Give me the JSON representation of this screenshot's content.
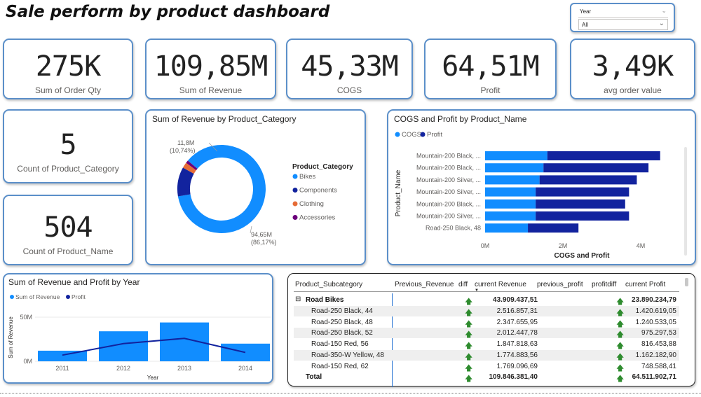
{
  "dashboard_title": "Sale perform by product dashboard",
  "slicer": {
    "label": "Year",
    "value": "All"
  },
  "kpis": [
    {
      "value": "275K",
      "label": "Sum of Order Qty"
    },
    {
      "value": "109,85M",
      "label": "Sum of Revenue"
    },
    {
      "value": "45,33M",
      "label": "COGS"
    },
    {
      "value": "64,51M",
      "label": "Profit"
    },
    {
      "value": "3,49K",
      "label": "avg order value"
    },
    {
      "value": "5",
      "label": "Count of Product_Category"
    },
    {
      "value": "504",
      "label": "Count of Product_Name"
    }
  ],
  "donut": {
    "title": "Sum of Revenue by Product_Category",
    "legend_title": "Product_Category",
    "label_small": "11,8M",
    "label_small_pct": "(10,74%)",
    "label_big": "94,65M",
    "label_big_pct": "(86,17%)"
  },
  "bar_h": {
    "title": "COGS and Profit by Product_Name",
    "ylabel": "Product_Name",
    "xlabel": "COGS and Profit",
    "ticks": [
      "0M",
      "2M",
      "4M"
    ]
  },
  "combo": {
    "title": "Sum of Revenue and Profit by Year",
    "ylabel": "Sum of Revenue",
    "xlabel": "Year",
    "yticks": [
      "50M",
      "0M"
    ]
  },
  "table": {
    "headers": [
      "Product_Subcategory",
      "Previous_Revenue",
      "diff",
      "current Revenue",
      "previous_profit",
      "profitdiff",
      "current Profit"
    ],
    "group": {
      "name": "Road Bikes",
      "revenue": "43.909.437,51",
      "profit": "23.890.234,79"
    },
    "rows": [
      {
        "name": "Road-250 Black, 44",
        "revenue": "2.516.857,31",
        "profit": "1.420.619,05"
      },
      {
        "name": "Road-250 Black, 48",
        "revenue": "2.347.655,95",
        "profit": "1.240.533,05"
      },
      {
        "name": "Road-250 Black, 52",
        "revenue": "2.012.447,78",
        "profit": "975.297,53"
      },
      {
        "name": "Road-150 Red, 56",
        "revenue": "1.847.818,63",
        "profit": "816.453,88"
      },
      {
        "name": "Road-350-W Yellow, 48",
        "revenue": "1.774.883,56",
        "profit": "1.162.182,90"
      },
      {
        "name": "Road-150 Red, 62",
        "revenue": "1.769.096,69",
        "profit": "748.588,41"
      }
    ],
    "total": {
      "name": "Total",
      "revenue": "109.846.381,40",
      "profit": "64.511.902,71"
    },
    "expand_symbol": "⊟",
    "arrow_symbol": "🡅"
  },
  "chart_data": [
    {
      "type": "pie",
      "title": "Sum of Revenue by Product_Category",
      "categories": [
        "Bikes",
        "Components",
        "Clothing",
        "Accessories"
      ],
      "values": [
        94.65,
        11.8,
        2.3,
        1.1
      ],
      "colors": [
        "#118dff",
        "#12239e",
        "#e66c37",
        "#6b007b"
      ],
      "legend": "right"
    },
    {
      "type": "bar",
      "title": "COGS and Profit by Product_Name",
      "orientation": "horizontal",
      "stacked": true,
      "categories": [
        "Mountain-200 Black, ...",
        "Mountain-200 Black, ...",
        "Mountain-200 Silver, ...",
        "Mountain-200 Silver, ...",
        "Mountain-200 Black, ...",
        "Mountain-200 Silver, ...",
        "Road-250 Black, 48"
      ],
      "series": [
        {
          "name": "COGS",
          "color": "#118dff",
          "values": [
            1.6,
            1.5,
            1.4,
            1.3,
            1.3,
            1.3,
            1.1
          ]
        },
        {
          "name": "Profit",
          "color": "#12239e",
          "values": [
            2.9,
            2.7,
            2.5,
            2.4,
            2.3,
            2.4,
            1.3
          ]
        }
      ],
      "xlabel": "COGS and Profit",
      "ylabel": "Product_Name",
      "xlim": [
        0,
        4.8
      ],
      "legend": "top-left"
    },
    {
      "type": "bar",
      "title": "Sum of Revenue and Profit by Year",
      "categories": [
        "2011",
        "2012",
        "2013",
        "2014"
      ],
      "series": [
        {
          "name": "Sum of Revenue",
          "kind": "bar",
          "color": "#118dff",
          "values": [
            12,
            34,
            44,
            20
          ]
        },
        {
          "name": "Profit",
          "kind": "line",
          "color": "#12239e",
          "values": [
            7,
            20,
            26,
            10
          ]
        }
      ],
      "xlabel": "Year",
      "ylabel": "Sum of Revenue",
      "ylim": [
        0,
        60
      ],
      "legend": "top-left"
    }
  ]
}
